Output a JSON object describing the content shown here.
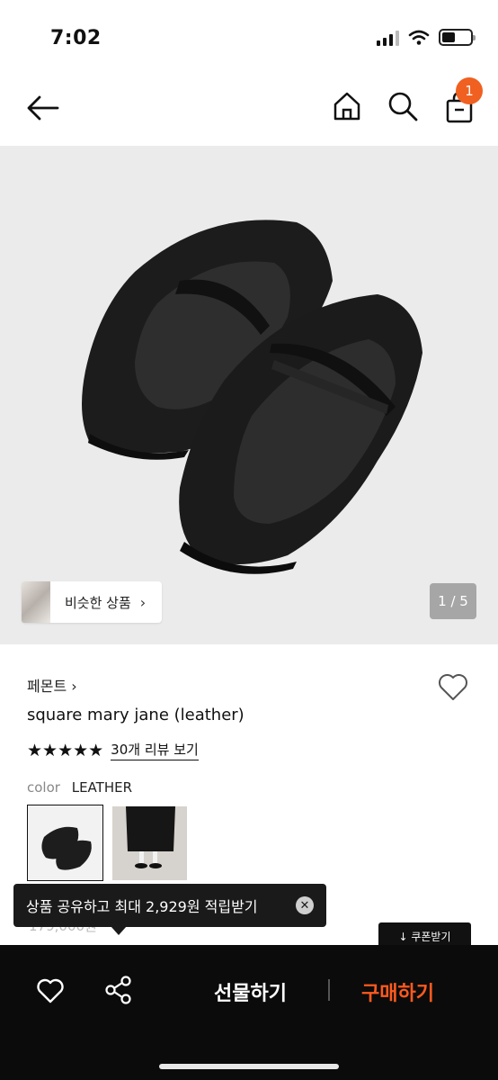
{
  "status_bar": {
    "time": "7:02"
  },
  "header": {
    "cart_count": "1"
  },
  "gallery": {
    "similar_label": "비슷한 상품",
    "similar_chevron": "›",
    "pager": "1 / 5"
  },
  "product": {
    "brand": "페몬트 ›",
    "title": "square mary jane (leather)",
    "stars": "★★★★★",
    "review_link": "30개 리뷰 보기",
    "option_label": "color",
    "option_value": "LEATHER",
    "price_partial": "179,000원"
  },
  "tooltip": {
    "text": "상품 공유하고 최대 2,929원 적립받기",
    "close": "✕"
  },
  "coupon": {
    "label": "↓ 쿠폰받기"
  },
  "bottom_bar": {
    "gift_label": "선물하기",
    "buy_label": "구매하기"
  },
  "colors": {
    "accent": "#ff5a1f",
    "badge": "#f06020",
    "bar_bg": "#0b0b0b"
  },
  "icons": [
    "back-arrow-icon",
    "home-icon",
    "search-icon",
    "shopping-bag-icon",
    "heart-icon",
    "share-icon",
    "close-icon"
  ]
}
